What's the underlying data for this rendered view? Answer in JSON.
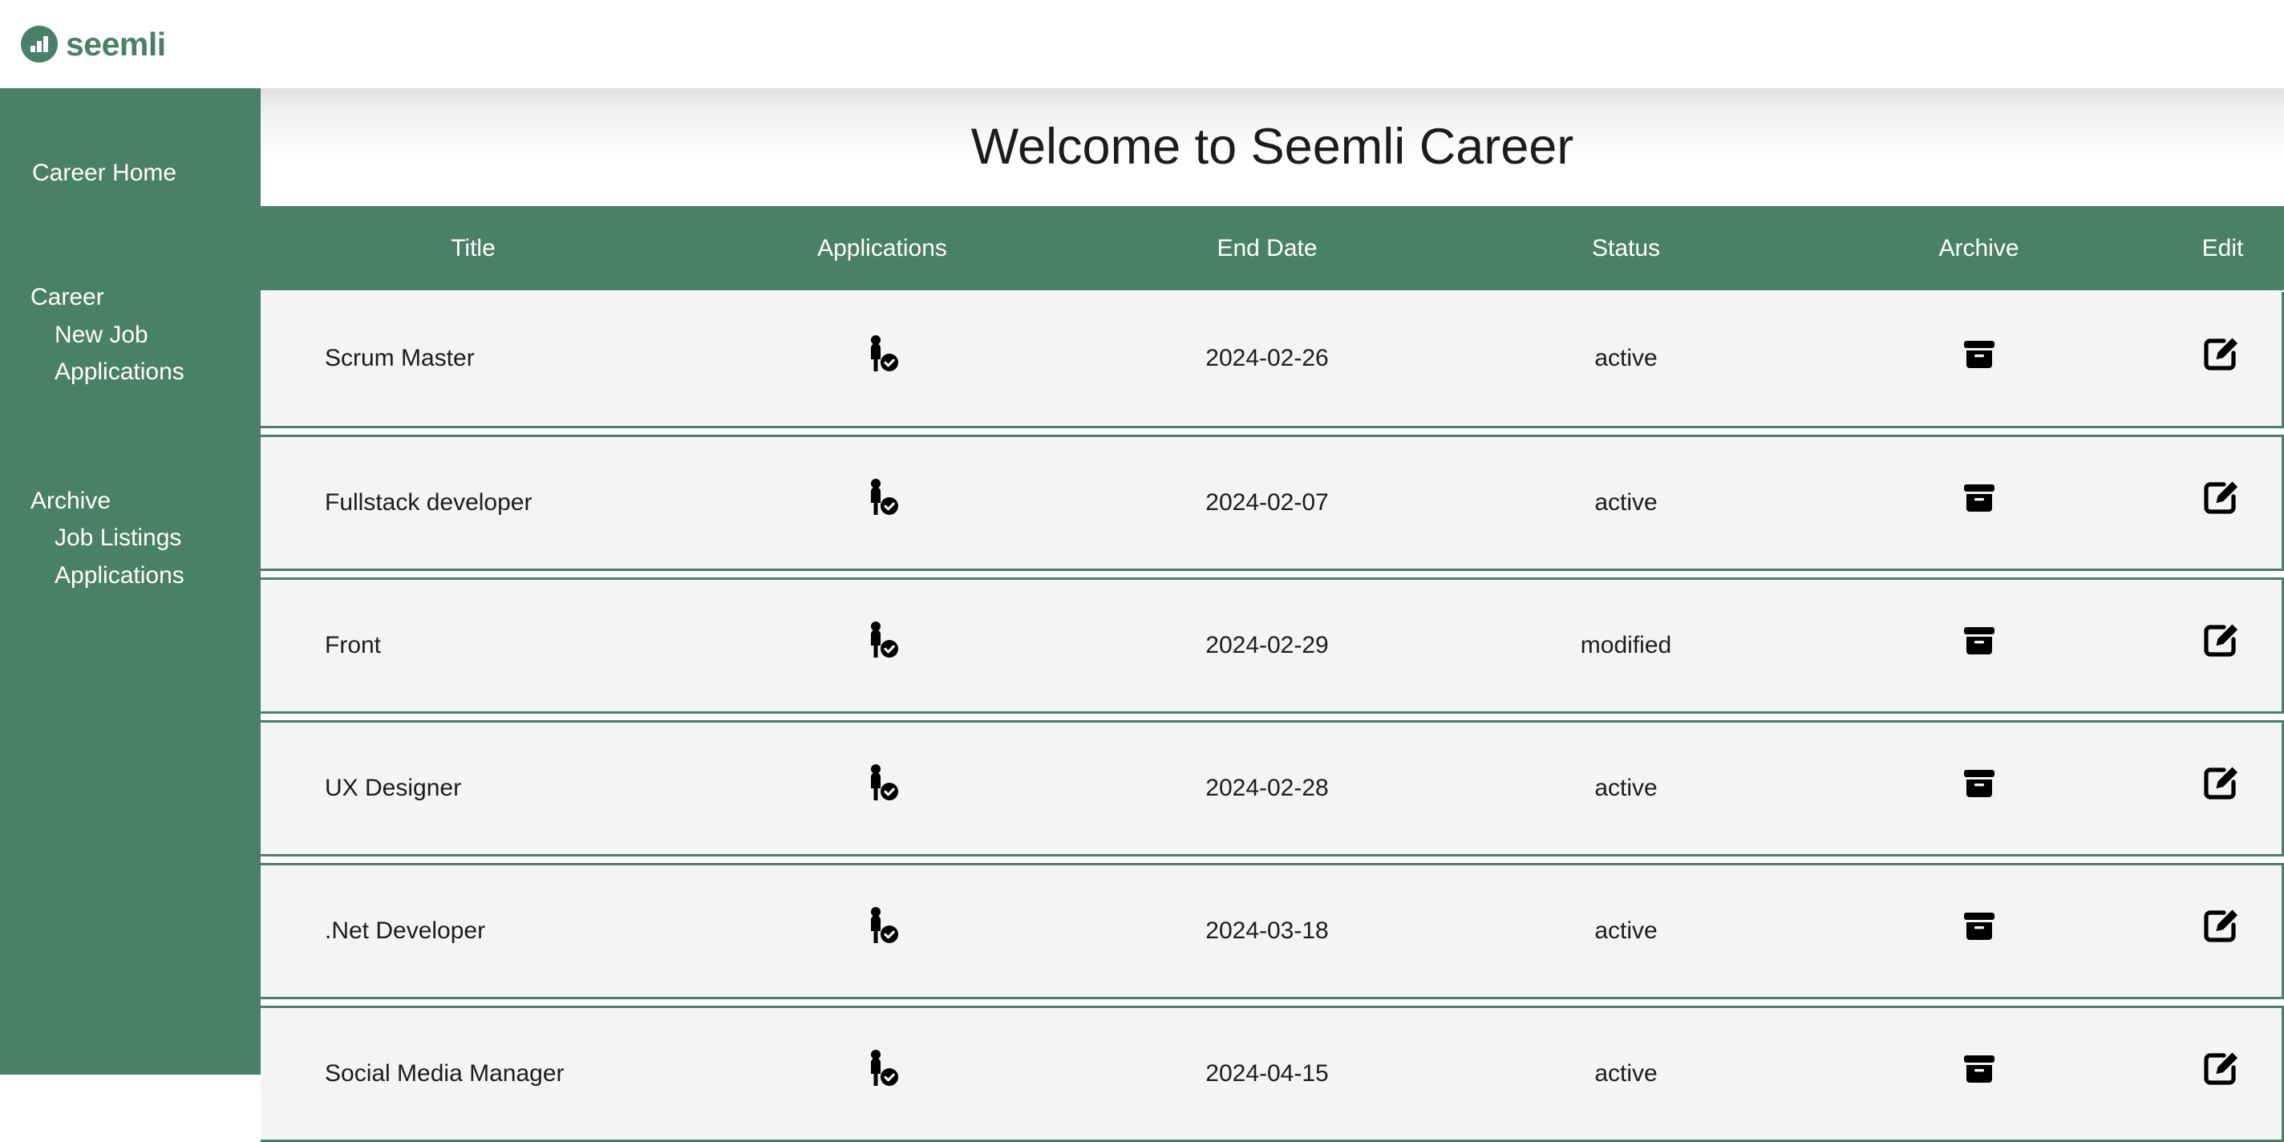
{
  "brand": {
    "name": "seemli",
    "logo_icon": "bar-chart-circle-icon",
    "color": "#4A8069"
  },
  "sidebar": {
    "home_label": "Career Home",
    "groups": [
      {
        "title": "Career",
        "items": [
          {
            "label": "New Job"
          },
          {
            "label": "Applications"
          }
        ]
      },
      {
        "title": "Archive",
        "items": [
          {
            "label": "Job Listings"
          },
          {
            "label": "Applications"
          }
        ]
      }
    ]
  },
  "main": {
    "page_title": "Welcome to Seemli Career"
  },
  "table": {
    "headers": {
      "title": "Title",
      "applications": "Applications",
      "end_date": "End Date",
      "status": "Status",
      "archive": "Archive",
      "edit": "Edit"
    },
    "row_icons": {
      "applications": "applicant-check-icon",
      "archive": "archive-box-icon",
      "edit": "edit-pencil-icon"
    },
    "rows": [
      {
        "title": "Scrum Master",
        "end_date": "2024-02-26",
        "status": "active"
      },
      {
        "title": "Fullstack developer",
        "end_date": "2024-02-07",
        "status": "active"
      },
      {
        "title": "Front",
        "end_date": "2024-02-29",
        "status": "modified"
      },
      {
        "title": "UX Designer",
        "end_date": "2024-02-28",
        "status": "active"
      },
      {
        "title": ".Net Developer",
        "end_date": "2024-03-18",
        "status": "active"
      },
      {
        "title": "Social Media Manager",
        "end_date": "2024-04-15",
        "status": "active"
      }
    ]
  }
}
